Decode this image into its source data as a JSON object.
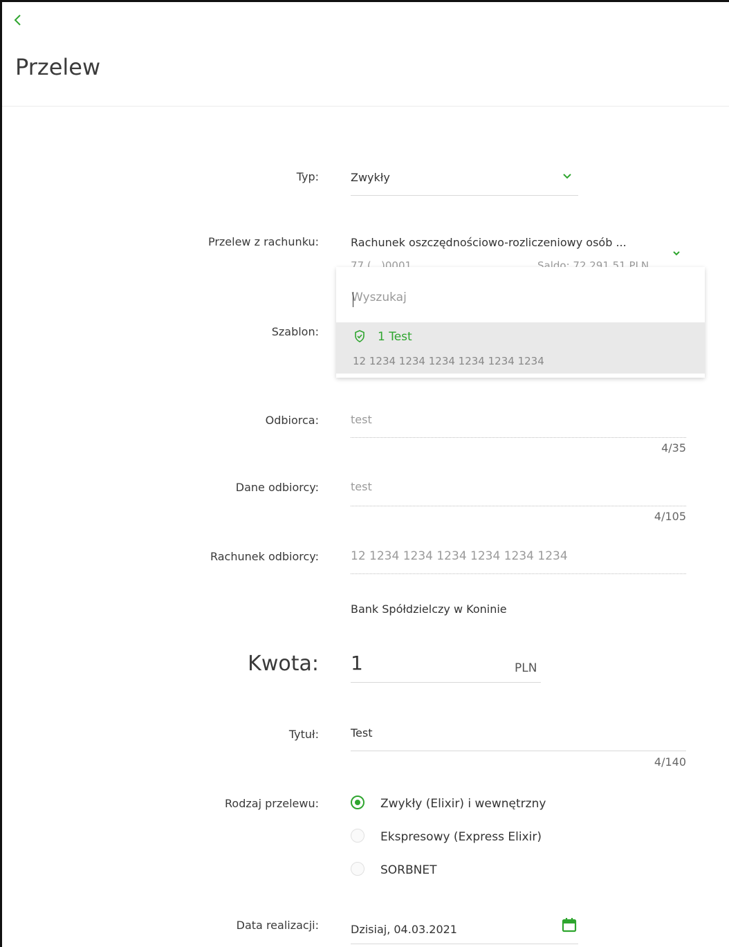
{
  "header": {
    "title": "Przelew"
  },
  "form": {
    "typ": {
      "label": "Typ:",
      "value": "Zwykły"
    },
    "from_account": {
      "label": "Przelew z rachunku:",
      "name": "Rachunek oszczędnościowo-rozliczeniowy osób ...",
      "number": "77 (...)0001",
      "balance": "Saldo: 72 291,51 PLN"
    },
    "szablon": {
      "label": "Szablon:"
    },
    "template_dropdown": {
      "search_placeholder": "Wyszukaj",
      "options": [
        {
          "name": "1 Test",
          "account": "12 1234 1234 1234 1234 1234 1234"
        }
      ]
    },
    "odbiorca": {
      "label": "Odbiorca:",
      "value": "test",
      "counter": "4/35"
    },
    "dane_odbiorcy": {
      "label": "Dane odbiorcy:",
      "value": "test",
      "counter": "4/105"
    },
    "rachunek_odbiorcy": {
      "label": "Rachunek odbiorcy:",
      "value": "12 1234 1234 1234 1234 1234 1234",
      "bank_name": "Bank Spółdzielczy w Koninie"
    },
    "kwota": {
      "label": "Kwota:",
      "value": "1",
      "currency": "PLN"
    },
    "tytul": {
      "label": "Tytuł:",
      "value": "Test",
      "counter": "4/140"
    },
    "rodzaj": {
      "label": "Rodzaj przelewu:",
      "options": [
        {
          "label": "Zwykły (Elixir) i wewnętrzny",
          "selected": true
        },
        {
          "label": "Ekspresowy (Express Elixir)",
          "selected": false
        },
        {
          "label": "SORBNET",
          "selected": false
        }
      ]
    },
    "data_realizacji": {
      "label": "Data realizacji:",
      "value": "Dzisiaj, 04.03.2021"
    }
  },
  "colors": {
    "accent": "#2ea52e",
    "text": "#333333",
    "muted": "#9a9a9a"
  },
  "icons": [
    "chevron-left-icon",
    "chevron-down-icon",
    "shield-check-icon",
    "calendar-icon"
  ]
}
